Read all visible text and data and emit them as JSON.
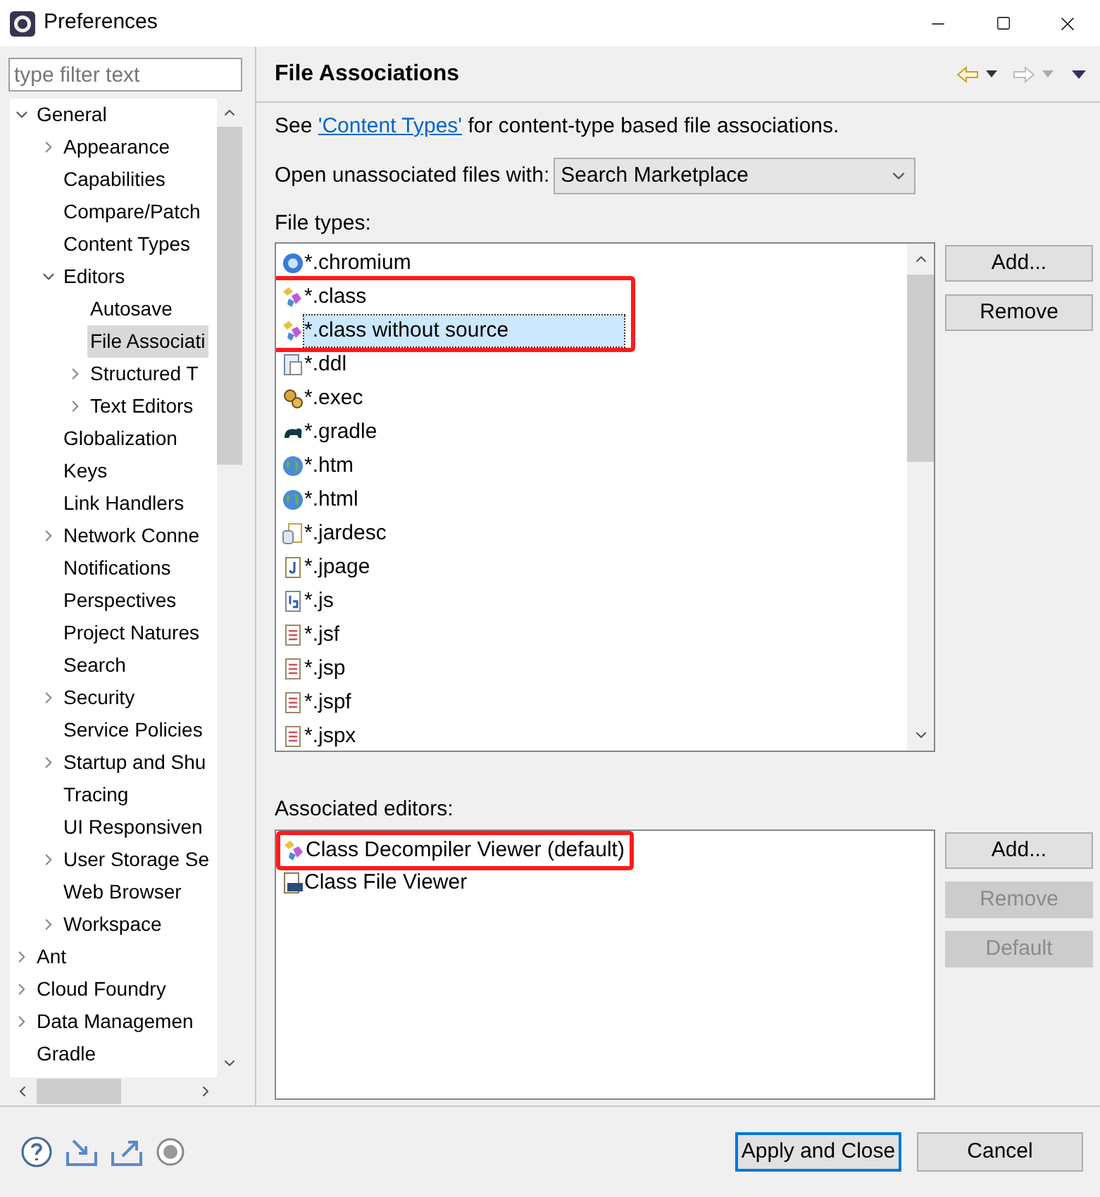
{
  "window": {
    "title": "Preferences"
  },
  "filter": {
    "placeholder": "type filter text"
  },
  "tree": [
    {
      "label": "General",
      "expanded": true,
      "selected": false,
      "children": [
        {
          "label": "Appearance",
          "expanded": false,
          "selected": false
        },
        {
          "label": "Capabilities",
          "selected": false
        },
        {
          "label": "Compare/Patch",
          "selected": false
        },
        {
          "label": "Content Types",
          "selected": false
        },
        {
          "label": "Editors",
          "expanded": true,
          "selected": false,
          "children": [
            {
              "label": "Autosave",
              "selected": false
            },
            {
              "label": "File Associati",
              "selected": true
            },
            {
              "label": "Structured T",
              "expanded": false,
              "selected": false
            },
            {
              "label": "Text Editors",
              "expanded": false,
              "selected": false
            }
          ]
        },
        {
          "label": "Globalization",
          "selected": false
        },
        {
          "label": "Keys",
          "selected": false
        },
        {
          "label": "Link Handlers",
          "selected": false
        },
        {
          "label": "Network Conne",
          "expanded": false,
          "selected": false
        },
        {
          "label": "Notifications",
          "selected": false
        },
        {
          "label": "Perspectives",
          "selected": false
        },
        {
          "label": "Project Natures",
          "selected": false
        },
        {
          "label": "Search",
          "selected": false
        },
        {
          "label": "Security",
          "expanded": false,
          "selected": false
        },
        {
          "label": "Service Policies",
          "selected": false
        },
        {
          "label": "Startup and Shu",
          "expanded": false,
          "selected": false
        },
        {
          "label": "Tracing",
          "selected": false
        },
        {
          "label": "UI Responsiven",
          "selected": false
        },
        {
          "label": "User Storage Se",
          "expanded": false,
          "selected": false
        },
        {
          "label": "Web Browser",
          "selected": false
        },
        {
          "label": "Workspace",
          "expanded": false,
          "selected": false
        }
      ]
    },
    {
      "label": "Ant",
      "expanded": false,
      "selected": false
    },
    {
      "label": "Cloud Foundry",
      "expanded": false,
      "selected": false
    },
    {
      "label": "Data Managemen",
      "expanded": false,
      "selected": false
    },
    {
      "label": "Gradle",
      "selected": false
    }
  ],
  "page": {
    "title": "File Associations",
    "intro": {
      "before": "See ",
      "link": "'Content Types'",
      "after": " for content-type based file associations."
    },
    "open_with": {
      "label": "Open unassociated files with:",
      "value": "Search Marketplace"
    },
    "file_types_label": "File types:",
    "file_types": [
      {
        "name": "*.chromium",
        "kind": "browser",
        "selected": false,
        "highlighted": false
      },
      {
        "name": "*.class",
        "kind": "class",
        "selected": false,
        "highlighted": true
      },
      {
        "name": "*.class without source",
        "kind": "class",
        "selected": true,
        "highlighted": true
      },
      {
        "name": "*.ddl",
        "kind": "table",
        "selected": false,
        "highlighted": false
      },
      {
        "name": "*.exec",
        "kind": "gears",
        "selected": false,
        "highlighted": false
      },
      {
        "name": "*.gradle",
        "kind": "elephant",
        "selected": false,
        "highlighted": false
      },
      {
        "name": "*.htm",
        "kind": "globe",
        "selected": false,
        "highlighted": false
      },
      {
        "name": "*.html",
        "kind": "globe",
        "selected": false,
        "highlighted": false
      },
      {
        "name": "*.jardesc",
        "kind": "jar",
        "selected": false,
        "highlighted": false
      },
      {
        "name": "*.jpage",
        "kind": "jpage",
        "selected": false,
        "highlighted": false
      },
      {
        "name": "*.js",
        "kind": "script",
        "selected": false,
        "highlighted": false
      },
      {
        "name": "*.jsf",
        "kind": "page",
        "selected": false,
        "highlighted": false
      },
      {
        "name": "*.jsp",
        "kind": "page",
        "selected": false,
        "highlighted": false
      },
      {
        "name": "*.jspf",
        "kind": "page",
        "selected": false,
        "highlighted": false
      },
      {
        "name": "*.jspx",
        "kind": "page",
        "selected": false,
        "highlighted": false
      }
    ],
    "file_type_buttons": [
      {
        "label": "Add...",
        "disabled": false
      },
      {
        "label": "Remove",
        "disabled": false
      }
    ],
    "editors_label": "Associated editors:",
    "editors": [
      {
        "name": "Class Decompiler Viewer (default)",
        "kind": "class",
        "highlighted": true
      },
      {
        "name": "Class File Viewer",
        "kind": "binary",
        "highlighted": false
      }
    ],
    "editor_buttons": [
      {
        "label": "Add...",
        "disabled": false
      },
      {
        "label": "Remove",
        "disabled": true
      },
      {
        "label": "Default",
        "disabled": true
      }
    ]
  },
  "footer_buttons": [
    {
      "label": "Apply and Close",
      "default": true
    },
    {
      "label": "Cancel",
      "default": false
    }
  ]
}
